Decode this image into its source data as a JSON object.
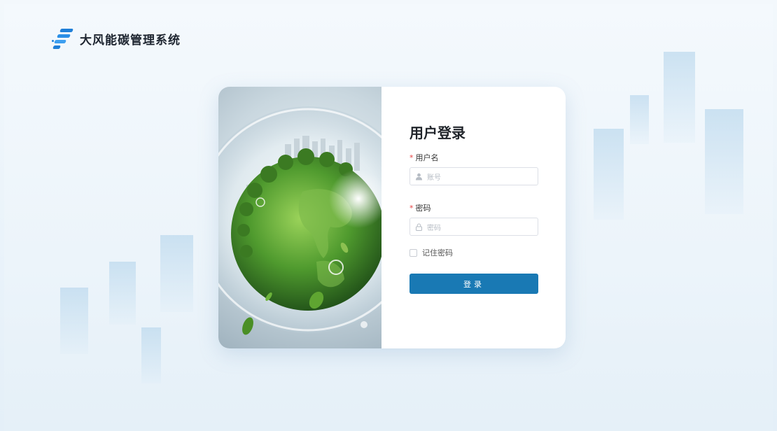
{
  "app": {
    "title": "大风能碳管理系统"
  },
  "login": {
    "heading": "用户登录",
    "username": {
      "label": "用户名",
      "required_mark": "*",
      "placeholder": "账号"
    },
    "password": {
      "label": "密码",
      "required_mark": "*",
      "placeholder": "密码"
    },
    "remember_label": "记住密码",
    "remember_checked": false,
    "submit_label": "登录"
  },
  "icons": {
    "logo": "app-logo-icon",
    "username": "user-icon",
    "password": "lock-icon"
  },
  "colors": {
    "primary": "#1979b4",
    "brand": "#1f7fd8",
    "required": "#e64242"
  }
}
